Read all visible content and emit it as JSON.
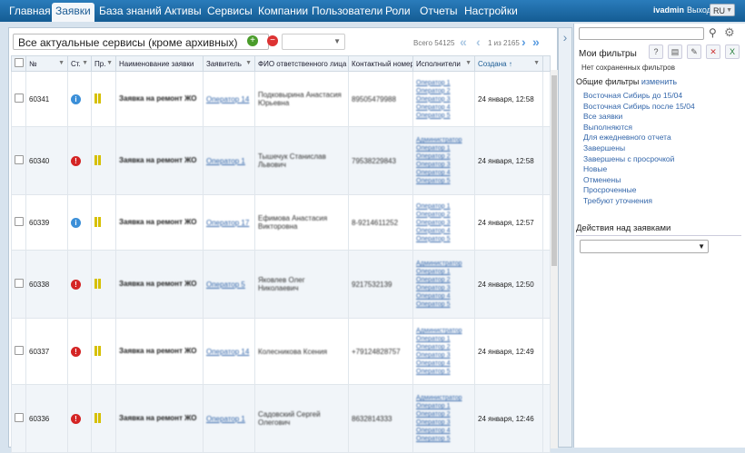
{
  "nav": {
    "tabs": [
      "Главная",
      "Заявки",
      "База знаний",
      "Активы",
      "Сервисы",
      "Компании",
      "Пользователи",
      "Роли",
      "Отчеты",
      "Настройки"
    ],
    "active_tab": "Заявки",
    "user": "ivadmin",
    "logout": "Выход",
    "lang": "RU"
  },
  "toolbar": {
    "filter_value": "Все актуальные сервисы (кроме архивных)",
    "total": "Всего 54125",
    "page_info": "1 из 2165"
  },
  "grid": {
    "columns": [
      "№",
      "Ст.",
      "Пр.",
      "Наименование заявки",
      "Заявитель",
      "ФИО ответственного лица",
      "Контактный номер",
      "Исполнители",
      "Создана ↑"
    ],
    "rows": [
      {
        "num": "60341",
        "status": "info",
        "name": "Заявка на ремонт ЖО",
        "applicant": "Оператор 14",
        "fio": "Подковырина Анастасия Юрьевна",
        "phone": "89505479988",
        "execs": [
          "Оператор 1",
          "Оператор 2",
          "Оператор 3",
          "Оператор 4",
          "Оператор 5"
        ],
        "created": "24 января, 12:58"
      },
      {
        "num": "60340",
        "status": "alert",
        "name": "Заявка на ремонт ЖО",
        "applicant": "Оператор 1",
        "fio": "Тышечук Станислав Львович",
        "phone": "79538229843",
        "execs": [
          "Администратор",
          "Оператор 1",
          "Оператор 2",
          "Оператор 3",
          "Оператор 4",
          "Оператор 5"
        ],
        "created": "24 января, 12:58"
      },
      {
        "num": "60339",
        "status": "info",
        "name": "Заявка на ремонт ЖО",
        "applicant": "Оператор 17",
        "fio": "Ефимова Анастасия Викторовна",
        "phone": "8-9214611252",
        "execs": [
          "Оператор 1",
          "Оператор 2",
          "Оператор 3",
          "Оператор 4",
          "Оператор 5"
        ],
        "created": "24 января, 12:57"
      },
      {
        "num": "60338",
        "status": "alert",
        "name": "Заявка на ремонт ЖО",
        "applicant": "Оператор 5",
        "fio": "Яковлев Олег Николаевич",
        "phone": "9217532139",
        "execs": [
          "Администратор",
          "Оператор 1",
          "Оператор 2",
          "Оператор 3",
          "Оператор 4",
          "Оператор 5"
        ],
        "created": "24 января, 12:50"
      },
      {
        "num": "60337",
        "status": "alert",
        "name": "Заявка на ремонт ЖО",
        "applicant": "Оператор 14",
        "fio": "Колесникова Ксения",
        "phone": "+79124828757",
        "execs": [
          "Администратор",
          "Оператор 1",
          "Оператор 2",
          "Оператор 3",
          "Оператор 4",
          "Оператор 5"
        ],
        "created": "24 января, 12:49"
      },
      {
        "num": "60336",
        "status": "alert",
        "name": "Заявка на ремонт ЖО",
        "applicant": "Оператор 1",
        "fio": "Садовский Сергей Олегович",
        "phone": "8632814333",
        "execs": [
          "Администратор",
          "Оператор 1",
          "Оператор 2",
          "Оператор 3",
          "Оператор 4",
          "Оператор 5"
        ],
        "created": "24 января, 12:46"
      }
    ]
  },
  "sidebar": {
    "my_filters": "Мои фильтры",
    "no_saved": "Нет сохраненных фильтров",
    "general_filters": "Общие фильтры",
    "change": "изменить",
    "filters": [
      "Восточная Сибирь до 15/04",
      "Восточная Сибирь после 15/04",
      "Все заявки",
      "Выполняются",
      "Для ежедневного отчета",
      "Завершены",
      "Завершены с просрочкой",
      "Новые",
      "Отменены",
      "Просроченные",
      "Требуют уточнения"
    ],
    "actions_title": "Действия над заявками"
  },
  "colors": {
    "nav": "#1d6ca8",
    "link": "#3366aa",
    "alert": "#d42424",
    "info": "#3b8fd8",
    "priority": "#d6c000"
  }
}
